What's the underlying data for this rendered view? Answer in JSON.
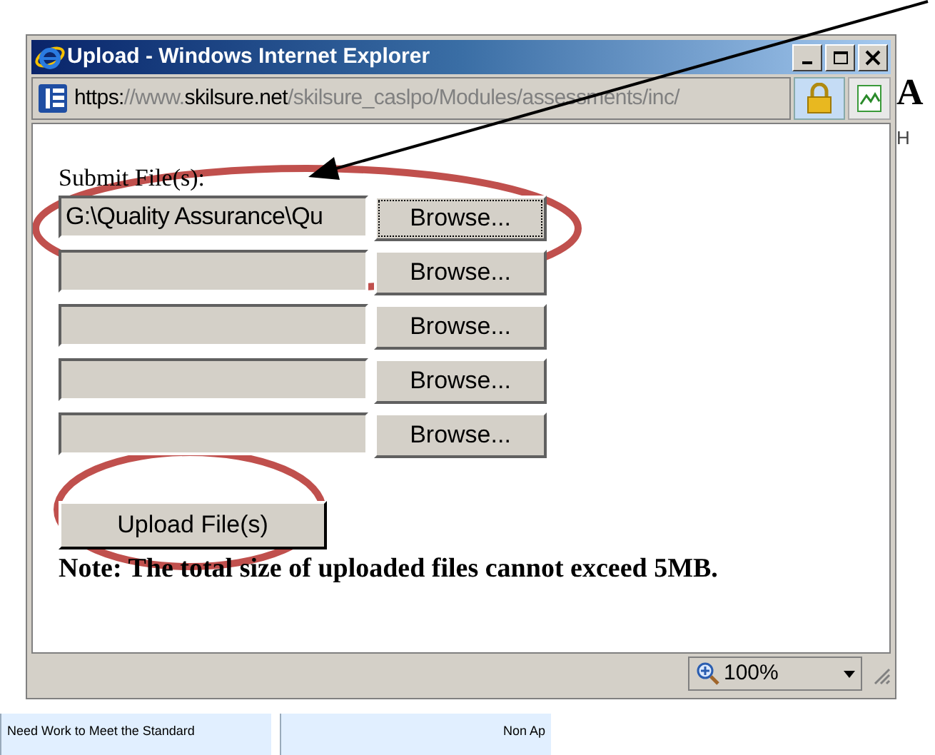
{
  "window": {
    "title": "Upload - Windows Internet Explorer"
  },
  "address": [
    {
      "text": "https:",
      "emphasis": true
    },
    {
      "text": "//www.",
      "emphasis": false
    },
    {
      "text": "skilsure.net",
      "emphasis": true
    },
    {
      "text": "/skilsure_caslpo/Modules/assessments/inc/",
      "emphasis": false
    }
  ],
  "form": {
    "label": "Submit File(s):",
    "files": [
      {
        "value": "G:\\Quality Assurance\\Qu",
        "button": "Browse...",
        "focused": true
      },
      {
        "button": "Browse...",
        "focused": false
      },
      {
        "button": "Browse...",
        "focused": false
      },
      {
        "button": "Browse...",
        "focused": false
      },
      {
        "button": "Browse...",
        "focused": false
      }
    ],
    "submit": "Upload File(s)",
    "note": "Note: The total size of uploaded files cannot exceed 5MB."
  },
  "status_bar": {
    "zoom": "100%"
  },
  "background_page": {
    "heading": "A",
    "subheading": "H",
    "columns": [
      "Need Work to Meet the Standard",
      "Non Ap"
    ]
  }
}
